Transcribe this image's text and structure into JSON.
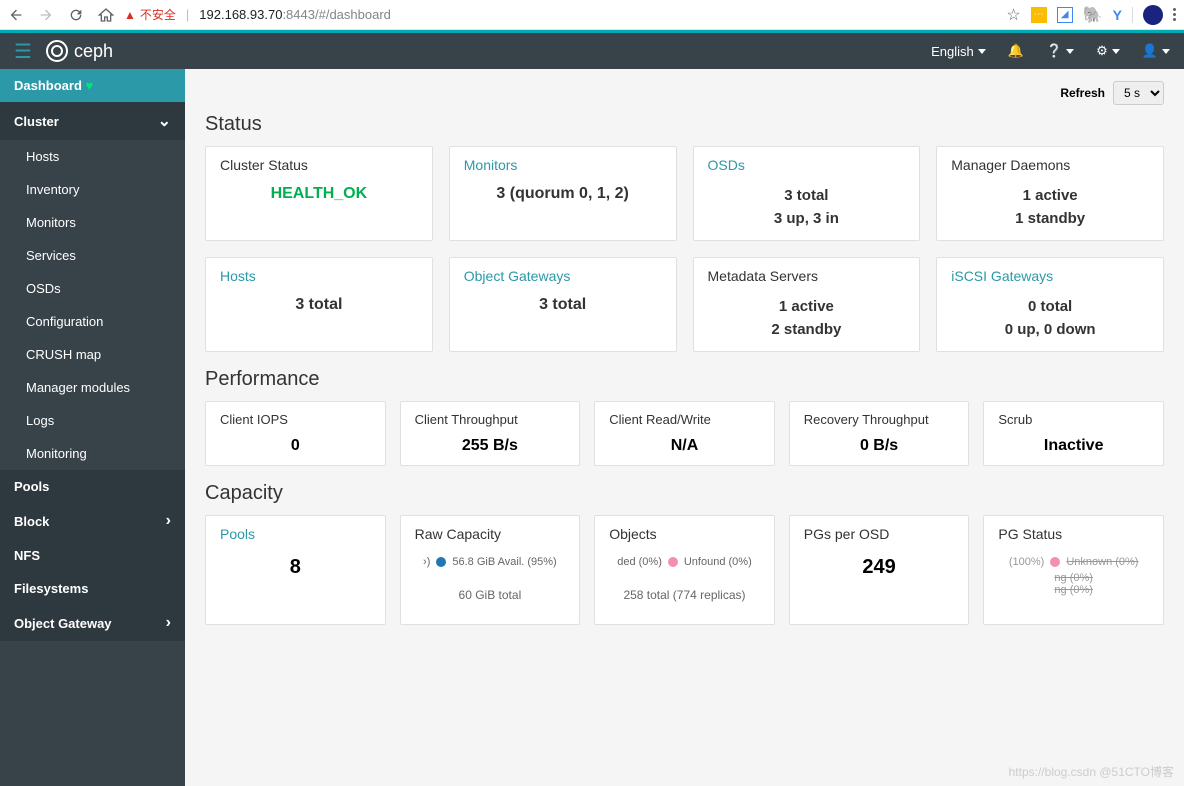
{
  "browser": {
    "insecure": "不安全",
    "url_host": "192.168.93.70",
    "url_port": ":8443",
    "url_path": "/#/dashboard"
  },
  "header": {
    "brand": "ceph",
    "language": "English"
  },
  "sidebar": {
    "dashboard": "Dashboard",
    "cluster": "Cluster",
    "cluster_items": [
      "Hosts",
      "Inventory",
      "Monitors",
      "Services",
      "OSDs",
      "Configuration",
      "CRUSH map",
      "Manager modules",
      "Logs",
      "Monitoring"
    ],
    "pools": "Pools",
    "block": "Block",
    "nfs": "NFS",
    "filesystems": "Filesystems",
    "object_gateway": "Object Gateway"
  },
  "refresh": {
    "label": "Refresh",
    "value": "5 s"
  },
  "status": {
    "title": "Status",
    "cluster_status": {
      "title": "Cluster Status",
      "value": "HEALTH_OK"
    },
    "monitors": {
      "title": "Monitors",
      "value": "3 (quorum 0, 1, 2)"
    },
    "osds": {
      "title": "OSDs",
      "line1": "3 total",
      "line2": "3 up, 3 in"
    },
    "mgr": {
      "title": "Manager Daemons",
      "line1": "1 active",
      "line2": "1 standby"
    },
    "hosts": {
      "title": "Hosts",
      "value": "3 total"
    },
    "obj_gw": {
      "title": "Object Gateways",
      "value": "3 total"
    },
    "mds": {
      "title": "Metadata Servers",
      "line1": "1 active",
      "line2": "2 standby"
    },
    "iscsi": {
      "title": "iSCSI Gateways",
      "line1": "0 total",
      "line2": "0 up, 0 down"
    }
  },
  "performance": {
    "title": "Performance",
    "iops": {
      "title": "Client IOPS",
      "value": "0"
    },
    "throughput": {
      "title": "Client Throughput",
      "value": "255 B/s"
    },
    "rw": {
      "title": "Client Read/Write",
      "value": "N/A"
    },
    "recovery": {
      "title": "Recovery Throughput",
      "value": "0 B/s"
    },
    "scrub": {
      "title": "Scrub",
      "value": "Inactive"
    }
  },
  "capacity": {
    "title": "Capacity",
    "pools": {
      "title": "Pools",
      "value": "8"
    },
    "raw": {
      "title": "Raw Capacity",
      "legend": "56.8 GiB Avail. (95%)",
      "total": "60 GiB total"
    },
    "objects": {
      "title": "Objects",
      "legend1": "ded (0%)",
      "legend2": "Unfound (0%)",
      "total": "258 total (774 replicas)"
    },
    "pgs": {
      "title": "PGs per OSD",
      "value": "249"
    },
    "pgstatus": {
      "title": "PG Status",
      "pct": "(100%)",
      "unknown": "Unknown (0%)",
      "ng1": "ng (0%)",
      "ng2": "ng (0%)"
    }
  },
  "watermark": "https://blog.csdn @51CTO博客"
}
